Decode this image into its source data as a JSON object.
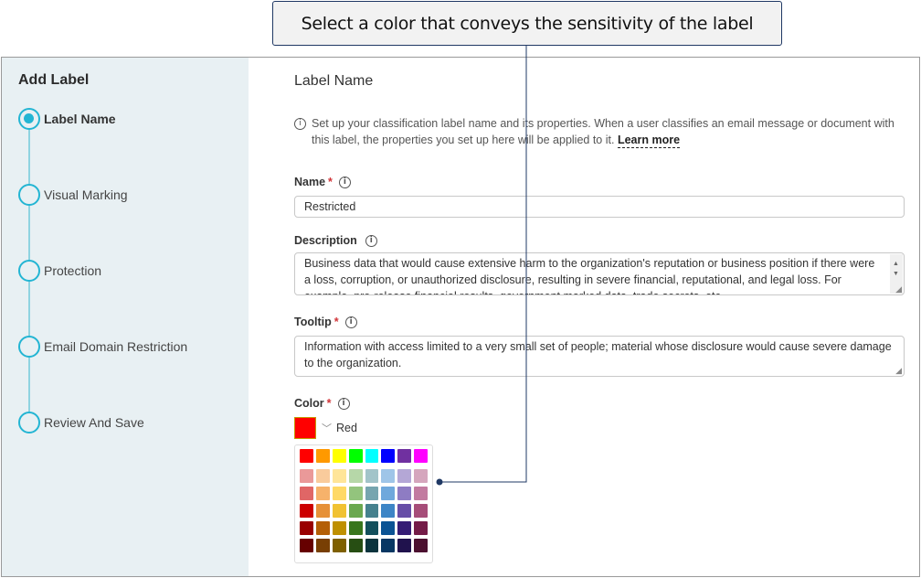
{
  "callout": {
    "text": "Select a color that conveys the sensitivity of the label"
  },
  "sidebar": {
    "title": "Add Label",
    "steps": [
      {
        "label": "Label Name",
        "active": true
      },
      {
        "label": "Visual Marking",
        "active": false
      },
      {
        "label": "Protection",
        "active": false
      },
      {
        "label": "Email Domain Restriction",
        "active": false
      },
      {
        "label": "Review And Save",
        "active": false
      }
    ]
  },
  "main": {
    "section_title": "Label Name",
    "intro": "Set up your classification label name and its properties. When a user classifies an email message or document with this label, the properties you set up here will be applied to it.",
    "learn_more": "Learn more",
    "name": {
      "label": "Name",
      "required": "*",
      "value": "Restricted"
    },
    "description": {
      "label": "Description",
      "value": "Business data that would cause extensive harm to the organization's reputation or business position if there were a loss, corruption, or unauthorized disclosure, resulting in severe financial, reputational, and legal loss. For example, pre-release financial results, government marked data, trade secrets, etc."
    },
    "tooltip": {
      "label": "Tooltip",
      "required": "*",
      "value": "Information with access limited to a very small set of people; material whose disclosure would cause severe damage to the organization."
    },
    "color": {
      "label": "Color",
      "required": "*",
      "selected_name": "Red",
      "selected_hex": "#ff0000",
      "palette": [
        [
          "#ff0000",
          "#ff9900",
          "#ffff00",
          "#00ff00",
          "#00ffff",
          "#0000ff",
          "#7030a0",
          "#ff00ff"
        ],
        [
          "#ea9999",
          "#f9cb9c",
          "#ffe599",
          "#b6d7a8",
          "#a2c4c9",
          "#9fc5e8",
          "#b4a7d6",
          "#d5a6bd"
        ],
        [
          "#e06666",
          "#f6b26b",
          "#ffd966",
          "#93c47d",
          "#76a5af",
          "#6fa8dc",
          "#8e7cc3",
          "#c27ba0"
        ],
        [
          "#cc0000",
          "#e69138",
          "#f1c232",
          "#6aa84f",
          "#45818e",
          "#3d85c6",
          "#674ea7",
          "#a64d79"
        ],
        [
          "#990000",
          "#b45f06",
          "#bf9000",
          "#38761d",
          "#134f5c",
          "#0b5394",
          "#351c75",
          "#741b47"
        ],
        [
          "#660000",
          "#783f04",
          "#7f6000",
          "#274e13",
          "#0c343d",
          "#073763",
          "#20124d",
          "#4c1130"
        ]
      ]
    }
  },
  "icons": {
    "info": "info-icon",
    "chevron": "chevron-down-icon"
  },
  "glyphs": {
    "info": "i",
    "chevron": "﹀",
    "scroll_up": "▲",
    "scroll_down": "▼",
    "resize": "◢"
  }
}
